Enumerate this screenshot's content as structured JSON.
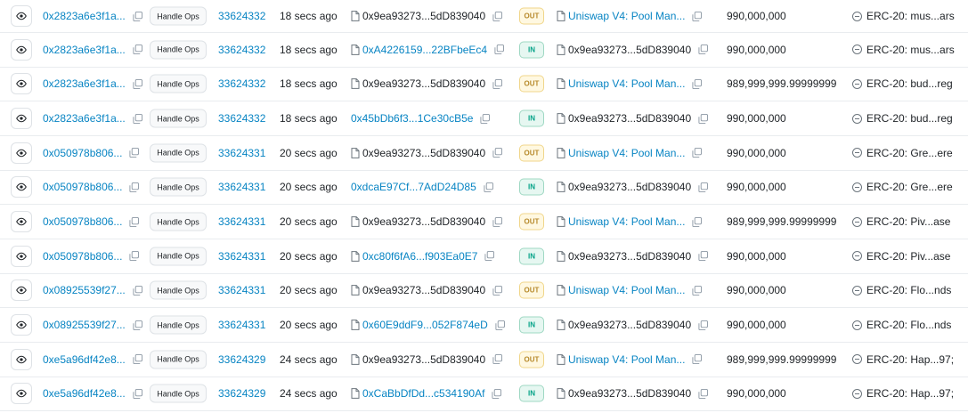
{
  "table": {
    "method_label": "Handle Ops",
    "rows": [
      {
        "txn": "0x2823a6e3f1a...",
        "block": "33624332",
        "age": "18 secs ago",
        "from": "0x9ea93273...5dD839040",
        "from_contract": true,
        "direction": "OUT",
        "to": "Uniswap V4: Pool Man...",
        "to_contract": true,
        "to_link": true,
        "amount": "990,000,000",
        "token": "ERC-20: mus...ars"
      },
      {
        "txn": "0x2823a6e3f1a...",
        "block": "33624332",
        "age": "18 secs ago",
        "from": "0xA4226159...22BFbeEc4",
        "from_contract": true,
        "direction": "IN",
        "to": "0x9ea93273...5dD839040",
        "to_contract": true,
        "to_link": false,
        "amount": "990,000,000",
        "token": "ERC-20: mus...ars"
      },
      {
        "txn": "0x2823a6e3f1a...",
        "block": "33624332",
        "age": "18 secs ago",
        "from": "0x9ea93273...5dD839040",
        "from_contract": true,
        "direction": "OUT",
        "to": "Uniswap V4: Pool Man...",
        "to_contract": true,
        "to_link": true,
        "amount": "989,999,999.99999999",
        "token": "ERC-20: bud...reg"
      },
      {
        "txn": "0x2823a6e3f1a...",
        "block": "33624332",
        "age": "18 secs ago",
        "from": "0x45bDb6f3...1Ce30cB5e",
        "from_contract": false,
        "direction": "IN",
        "to": "0x9ea93273...5dD839040",
        "to_contract": true,
        "to_link": false,
        "amount": "990,000,000",
        "token": "ERC-20: bud...reg"
      },
      {
        "txn": "0x050978b806...",
        "block": "33624331",
        "age": "20 secs ago",
        "from": "0x9ea93273...5dD839040",
        "from_contract": true,
        "direction": "OUT",
        "to": "Uniswap V4: Pool Man...",
        "to_contract": true,
        "to_link": true,
        "amount": "990,000,000",
        "token": "ERC-20: Gre...ere"
      },
      {
        "txn": "0x050978b806...",
        "block": "33624331",
        "age": "20 secs ago",
        "from": "0xdcaE97Cf...7AdD24D85",
        "from_contract": false,
        "direction": "IN",
        "to": "0x9ea93273...5dD839040",
        "to_contract": true,
        "to_link": false,
        "amount": "990,000,000",
        "token": "ERC-20: Gre...ere"
      },
      {
        "txn": "0x050978b806...",
        "block": "33624331",
        "age": "20 secs ago",
        "from": "0x9ea93273...5dD839040",
        "from_contract": true,
        "direction": "OUT",
        "to": "Uniswap V4: Pool Man...",
        "to_contract": true,
        "to_link": true,
        "amount": "989,999,999.99999999",
        "token": "ERC-20: Piv...ase"
      },
      {
        "txn": "0x050978b806...",
        "block": "33624331",
        "age": "20 secs ago",
        "from": "0xc80f6fA6...f903Ea0E7",
        "from_contract": true,
        "direction": "IN",
        "to": "0x9ea93273...5dD839040",
        "to_contract": true,
        "to_link": false,
        "amount": "990,000,000",
        "token": "ERC-20: Piv...ase"
      },
      {
        "txn": "0x08925539f27...",
        "block": "33624331",
        "age": "20 secs ago",
        "from": "0x9ea93273...5dD839040",
        "from_contract": true,
        "direction": "OUT",
        "to": "Uniswap V4: Pool Man...",
        "to_contract": true,
        "to_link": true,
        "amount": "990,000,000",
        "token": "ERC-20: Flo...nds"
      },
      {
        "txn": "0x08925539f27...",
        "block": "33624331",
        "age": "20 secs ago",
        "from": "0x60E9ddF9...052F874eD",
        "from_contract": true,
        "direction": "IN",
        "to": "0x9ea93273...5dD839040",
        "to_contract": true,
        "to_link": false,
        "amount": "990,000,000",
        "token": "ERC-20: Flo...nds"
      },
      {
        "txn": "0xe5a96df42e8...",
        "block": "33624329",
        "age": "24 secs ago",
        "from": "0x9ea93273...5dD839040",
        "from_contract": true,
        "direction": "OUT",
        "to": "Uniswap V4: Pool Man...",
        "to_contract": true,
        "to_link": true,
        "amount": "989,999,999.99999999",
        "token": "ERC-20: Hap...97;"
      },
      {
        "txn": "0xe5a96df42e8...",
        "block": "33624329",
        "age": "24 secs ago",
        "from": "0xCaBbDfDd...c534190Af",
        "from_contract": true,
        "direction": "IN",
        "to": "0x9ea93273...5dD839040",
        "to_contract": true,
        "to_link": false,
        "amount": "990,000,000",
        "token": "ERC-20: Hap...97;"
      }
    ]
  },
  "colors": {
    "link": "#0784c3",
    "out_badge": "#b7892b",
    "in_badge": "#00a186"
  }
}
